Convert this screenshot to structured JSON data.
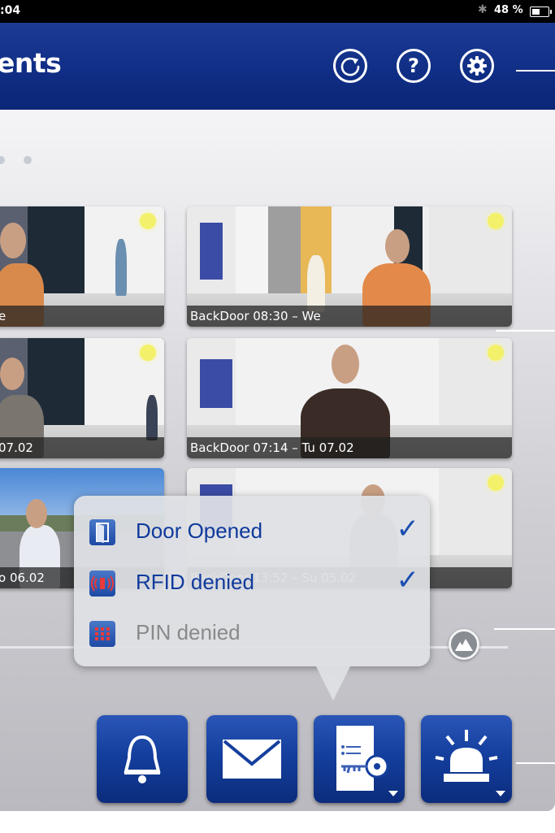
{
  "status_bar": {
    "time": ":04",
    "battery": "48 %"
  },
  "nav": {
    "title": "ents",
    "buttons": [
      {
        "name": "refresh",
        "icon": "refresh-icon"
      },
      {
        "name": "help",
        "icon": "question-icon",
        "label": "?"
      },
      {
        "name": "settings",
        "icon": "gear-icon"
      }
    ]
  },
  "events": [
    {
      "caption": "e"
    },
    {
      "caption": "BackDoor 08:30 – We"
    },
    {
      "caption": "07.02"
    },
    {
      "caption": "BackDoor 07:14 – Tu 07.02"
    },
    {
      "caption": "o 06.02"
    },
    {
      "caption": "BackDoor 13:52 – Su 05.02"
    }
  ],
  "filter_popover": {
    "items": [
      {
        "label": "Door Opened",
        "checked": true,
        "icon": "door-icon",
        "enabled": true
      },
      {
        "label": "RFID denied",
        "checked": true,
        "icon": "rfid-icon",
        "enabled": true
      },
      {
        "label": "PIN denied",
        "checked": false,
        "icon": "keypad-icon",
        "enabled": false
      }
    ]
  },
  "actions": [
    {
      "name": "bell",
      "icon": "bell-icon"
    },
    {
      "name": "message",
      "icon": "envelope-icon"
    },
    {
      "name": "door-key",
      "icon": "door-key-icon"
    },
    {
      "name": "alarm",
      "icon": "alarm-light-icon"
    }
  ],
  "colors": {
    "brand_blue": "#0f2d84",
    "check_blue": "#1a4fb0",
    "label_blue": "#0f3a9c",
    "disabled_gray": "#8a8a8a"
  }
}
